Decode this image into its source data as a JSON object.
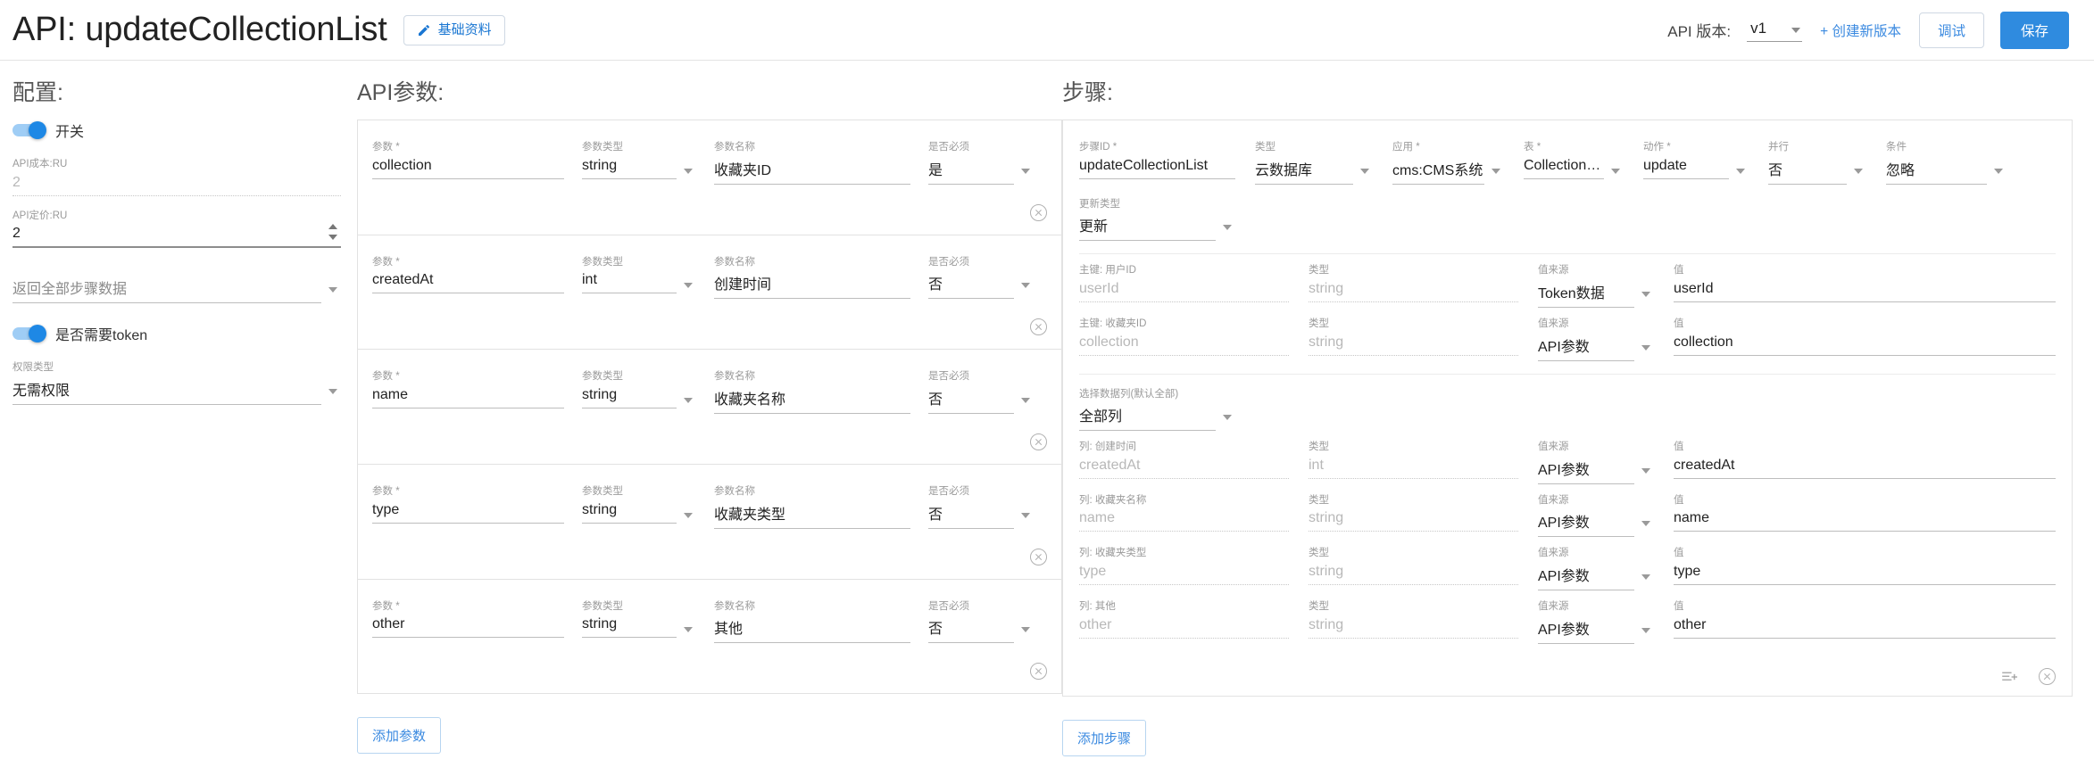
{
  "header": {
    "title": "API: updateCollectionList",
    "edit_button": "基础资料",
    "edit_icon": "pencil-icon",
    "version_label": "API 版本:",
    "version_value": "v1",
    "create_version": "+ 创建新版本",
    "debug_button": "调试",
    "save_button": "保存",
    "accent": "#2f8bdf"
  },
  "config": {
    "title": "配置:",
    "switch_label": "开关",
    "switch_on": true,
    "cost_label": "API成本:RU",
    "cost_value": "2",
    "price_label": "API定价:RU",
    "price_value": "2",
    "return_all_steps": "返回全部步骤数据",
    "token_label": "是否需要token",
    "token_on": true,
    "permission_label": "权限类型",
    "permission_value": "无需权限"
  },
  "params": {
    "title": "API参数:",
    "columns": {
      "name": "参数",
      "type": "参数类型",
      "display": "参数名称",
      "required": "是否必须"
    },
    "required_mark": "*",
    "rows": [
      {
        "name": "collection",
        "type": "string",
        "display": "收藏夹ID",
        "required": "是"
      },
      {
        "name": "createdAt",
        "type": "int",
        "display": "创建时间",
        "required": "否"
      },
      {
        "name": "name",
        "type": "string",
        "display": "收藏夹名称",
        "required": "否"
      },
      {
        "name": "type",
        "type": "string",
        "display": "收藏夹类型",
        "required": "否"
      },
      {
        "name": "other",
        "type": "string",
        "display": "其他",
        "required": "否"
      }
    ],
    "add_button": "添加参数"
  },
  "steps": {
    "title": "步骤:",
    "top_fields": [
      {
        "label": "步骤ID",
        "required": true,
        "value": "updateCollectionList",
        "kind": "text"
      },
      {
        "label": "类型",
        "required": false,
        "value": "云数据库",
        "kind": "select"
      },
      {
        "label": "应用",
        "required": true,
        "value": "cms:CMS系统",
        "kind": "select"
      },
      {
        "label": "表",
        "required": true,
        "value": "CollectionList",
        "kind": "select"
      },
      {
        "label": "动作",
        "required": true,
        "value": "update",
        "kind": "select"
      },
      {
        "label": "并行",
        "required": false,
        "value": "否",
        "kind": "select"
      },
      {
        "label": "条件",
        "required": false,
        "value": "忽略",
        "kind": "select"
      }
    ],
    "update_type": {
      "label": "更新类型",
      "value": "更新"
    },
    "key_rows": [
      {
        "key_label": "主键: 用户ID",
        "key_value": "userId",
        "type_label": "类型",
        "type_value": "string",
        "source_label": "值来源",
        "source_value": "Token数据",
        "value_label": "值",
        "value_value": "userId"
      },
      {
        "key_label": "主键: 收藏夹ID",
        "key_value": "collection",
        "type_label": "类型",
        "type_value": "string",
        "source_label": "值来源",
        "source_value": "API参数",
        "value_label": "值",
        "value_value": "collection"
      }
    ],
    "column_select": {
      "label": "选择数据列(默认全部)",
      "value": "全部列"
    },
    "column_rows": [
      {
        "key_label": "列: 创建时间",
        "key_value": "createdAt",
        "type_label": "类型",
        "type_value": "int",
        "source_label": "值来源",
        "source_value": "API参数",
        "value_label": "值",
        "value_value": "createdAt"
      },
      {
        "key_label": "列: 收藏夹名称",
        "key_value": "name",
        "type_label": "类型",
        "type_value": "string",
        "source_label": "值来源",
        "source_value": "API参数",
        "value_label": "值",
        "value_value": "name"
      },
      {
        "key_label": "列: 收藏夹类型",
        "key_value": "type",
        "type_label": "类型",
        "type_value": "string",
        "source_label": "值来源",
        "source_value": "API参数",
        "value_label": "值",
        "value_value": "type"
      },
      {
        "key_label": "列: 其他",
        "key_value": "other",
        "type_label": "类型",
        "type_value": "string",
        "source_label": "值来源",
        "source_value": "API参数",
        "value_label": "值",
        "value_value": "other"
      }
    ],
    "footer_icons": [
      "add-list-icon",
      "close-circle-icon"
    ],
    "add_button": "添加步骤"
  }
}
